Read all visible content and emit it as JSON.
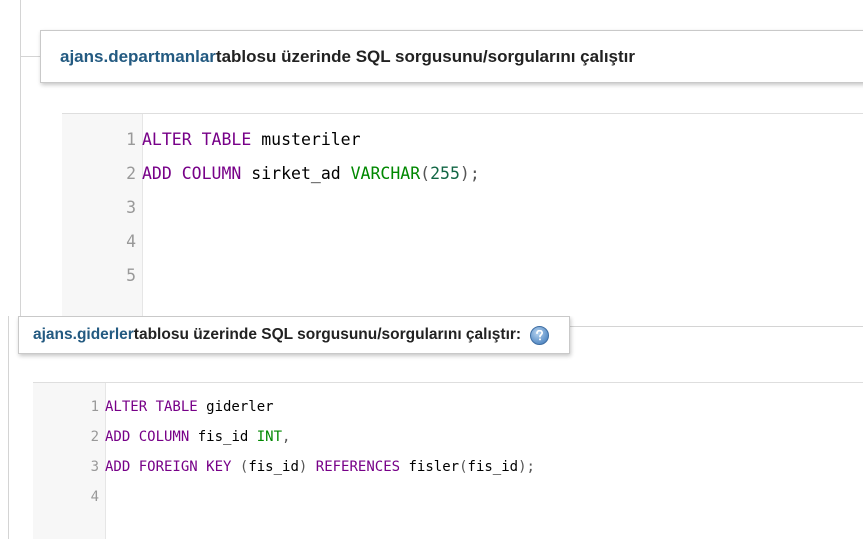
{
  "panel1": {
    "table_name": "ajans.departmanlar",
    "title_rest": " tablosu üzerinde SQL sorgusunu/sorgularını çalıştır",
    "lines": [
      {
        "n": "1",
        "tokens": [
          {
            "t": "ALTER TABLE",
            "c": "kw"
          },
          {
            "t": " musteriler",
            "c": "id"
          }
        ]
      },
      {
        "n": "2",
        "tokens": [
          {
            "t": "ADD COLUMN",
            "c": "kw"
          },
          {
            "t": " sirket_ad ",
            "c": "id"
          },
          {
            "t": "VARCHAR",
            "c": "ty"
          },
          {
            "t": "(",
            "c": "br"
          },
          {
            "t": "255",
            "c": "num"
          },
          {
            "t": ");",
            "c": "br"
          }
        ]
      },
      {
        "n": "3",
        "tokens": []
      },
      {
        "n": "4",
        "tokens": []
      },
      {
        "n": "5",
        "tokens": []
      }
    ]
  },
  "panel2": {
    "table_name": "ajans.giderler",
    "title_rest": " tablosu üzerinde SQL sorgusunu/sorgularını çalıştır:",
    "help_icon": "question-help-icon",
    "lines": [
      {
        "n": "1",
        "tokens": [
          {
            "t": "ALTER TABLE",
            "c": "kw"
          },
          {
            "t": " giderler",
            "c": "id"
          }
        ]
      },
      {
        "n": "2",
        "tokens": [
          {
            "t": "ADD COLUMN",
            "c": "kw"
          },
          {
            "t": " fis_id ",
            "c": "id"
          },
          {
            "t": "INT",
            "c": "ty"
          },
          {
            "t": ",",
            "c": "br"
          }
        ]
      },
      {
        "n": "3",
        "tokens": [
          {
            "t": "ADD FOREIGN KEY",
            "c": "kw"
          },
          {
            "t": " ",
            "c": "id"
          },
          {
            "t": "(",
            "c": "br"
          },
          {
            "t": "fis_id",
            "c": "id"
          },
          {
            "t": ")",
            "c": "br"
          },
          {
            "t": " ",
            "c": "id"
          },
          {
            "t": "REFERENCES",
            "c": "kw"
          },
          {
            "t": " fisler",
            "c": "id"
          },
          {
            "t": "(",
            "c": "br"
          },
          {
            "t": "fis_id",
            "c": "id"
          },
          {
            "t": ");",
            "c": "br"
          }
        ]
      },
      {
        "n": "4",
        "tokens": []
      }
    ]
  },
  "colors": {
    "table_link": "#235a81",
    "keyword": "#770088",
    "type": "#008800",
    "number": "#116644"
  }
}
